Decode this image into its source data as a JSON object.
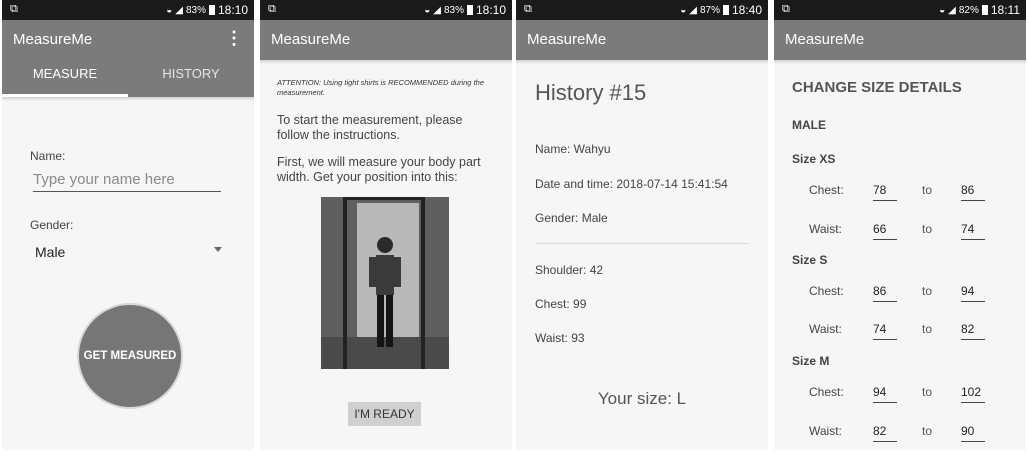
{
  "status": {
    "panel1": {
      "battery": "83%",
      "time": "18:10"
    },
    "panel2": {
      "battery": "83%",
      "time": "18:10"
    },
    "panel3": {
      "battery": "87%",
      "time": "18:40"
    },
    "panel4": {
      "battery": "82%",
      "time": "18:11"
    }
  },
  "app_title": "MeasureMe",
  "measure_screen": {
    "tabs": [
      "MEASURE",
      "HISTORY"
    ],
    "name_label": "Name:",
    "name_placeholder": "Type your name here",
    "gender_label": "Gender:",
    "gender_value": "Male",
    "get_measured": "GET MEASURED"
  },
  "instruction_screen": {
    "attention": "ATTENTION: Using tight shirts is RECOMMENDED during the measurement.",
    "line1": "To start the measurement, please follow the instructions.",
    "line2": "First, we will measure your body part width. Get your position into this:",
    "ready": "I'M READY"
  },
  "history_screen": {
    "title": "History #15",
    "name": "Name: Wahyu",
    "datetime": "Date and time: 2018-07-14 15:41:54",
    "gender": "Gender: Male",
    "shoulder": "Shoulder: 42",
    "chest": "Chest: 99",
    "waist": "Waist: 93",
    "your_size": "Your size: L"
  },
  "size_screen": {
    "title": "CHANGE SIZE DETAILS",
    "gender": "MALE",
    "to": "to",
    "chest_label": "Chest:",
    "waist_label": "Waist:",
    "sizes": [
      {
        "name": "Size XS",
        "chest": [
          "78",
          "86"
        ],
        "waist": [
          "66",
          "74"
        ]
      },
      {
        "name": "Size S",
        "chest": [
          "86",
          "94"
        ],
        "waist": [
          "74",
          "82"
        ]
      },
      {
        "name": "Size M",
        "chest": [
          "94",
          "102"
        ],
        "waist": [
          "82",
          "90"
        ]
      }
    ]
  },
  "colors": {
    "appbar": "#7b7b7b",
    "statusbar": "#1a1a1a",
    "button": "#767676"
  }
}
